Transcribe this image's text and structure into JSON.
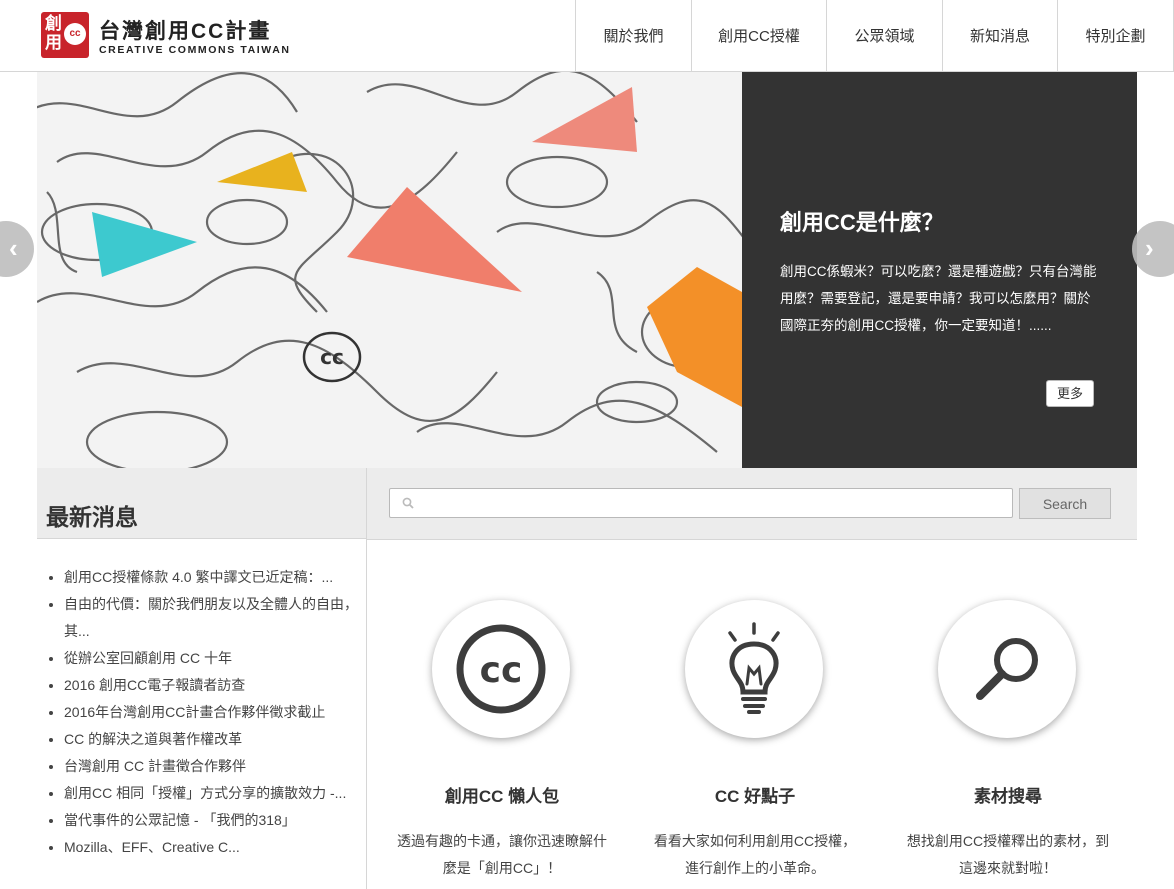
{
  "header": {
    "logo_seal_text": "創用",
    "logo_cc": "cc",
    "logo_title": "台灣創用CC計畫",
    "logo_subtitle": "CREATIVE COMMONS TAIWAN",
    "nav": [
      "關於我們",
      "創用CC授權",
      "公眾領域",
      "新知消息",
      "特別企劃"
    ]
  },
  "slider": {
    "title": "創用CC是什麼？",
    "description": "創用CC係蝦米？可以吃麼？還是種遊戲？只有台灣能用麼？需要登記，還是要申請？我可以怎麼用？關於國際正夯的創用CC授權，你一定要知道！......",
    "more_label": "更多",
    "image_cc_symbol": "cc",
    "prev_arrow": "‹",
    "next_arrow": "›"
  },
  "news": {
    "heading": "最新消息",
    "items": [
      "創用CC授權條款 4.0 繁中譯文已近定稿：...",
      "自由的代價：關於我們朋友以及全體人的自由，其...",
      "從辦公室回顧創用 CC 十年",
      "2016 創用CC電子報讀者訪查",
      "2016年台灣創用CC計畫合作夥伴徵求截止",
      "CC 的解決之道與著作權改革",
      "台灣創用 CC 計畫徵合作夥伴",
      "創用CC 相同「授權」方式分享的擴散效力 -...",
      "當代事件的公眾記憶 - 「我們的318」",
      "Mozilla、EFF、Creative C..."
    ]
  },
  "search": {
    "placeholder": "",
    "button_label": "Search"
  },
  "features": [
    {
      "icon": "cc-icon",
      "icon_text": "cc",
      "title": "創用CC 懶人包",
      "text": "透過有趣的卡通，讓你迅速瞭解什麼是「創用CC」！"
    },
    {
      "icon": "lightbulb-icon",
      "title": "CC 好點子",
      "text": "看看大家如何利用創用CC授權，進行創作上的小革命。"
    },
    {
      "icon": "magnifier-icon",
      "title": "素材搜尋",
      "text": "想找創用CC授權釋出的素材，到這邊來就對啦！"
    }
  ],
  "colors": {
    "brand_red": "#c8242b",
    "panel_dark": "#333333",
    "band_gray": "#ececec"
  }
}
